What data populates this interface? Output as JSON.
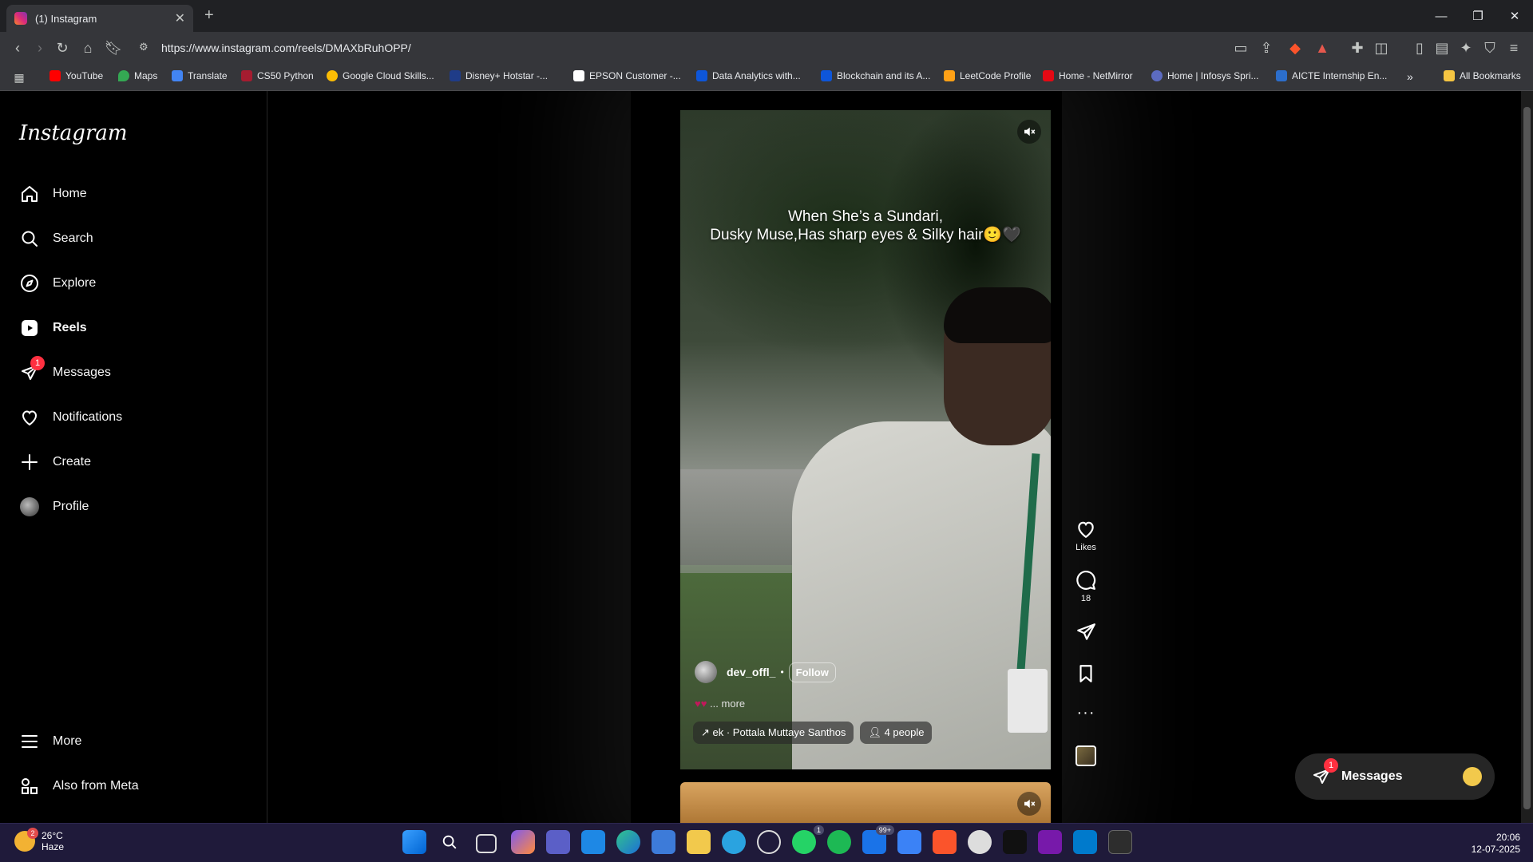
{
  "browser": {
    "tab_title": "(1) Instagram",
    "url": "https://www.instagram.com/reels/DMAXbRuhOPP/",
    "bookmarks": [
      "YouTube",
      "Maps",
      "Translate",
      "CS50 Python",
      "Google Cloud Skills...",
      "Disney+ Hotstar -...",
      "EPSON Customer -...",
      "Data Analytics with...",
      "Blockchain and its A...",
      "LeetCode Profile",
      "Home - NetMirror",
      "Home | Infosys Spri...",
      "AICTE Internship En..."
    ],
    "all_bookmarks": "All Bookmarks"
  },
  "sidebar": {
    "logo": "Instagram",
    "items": [
      {
        "label": "Home",
        "icon": "home-icon"
      },
      {
        "label": "Search",
        "icon": "search-icon"
      },
      {
        "label": "Explore",
        "icon": "compass-icon"
      },
      {
        "label": "Reels",
        "icon": "reels-icon"
      },
      {
        "label": "Messages",
        "icon": "messenger-icon",
        "badge": "1"
      },
      {
        "label": "Notifications",
        "icon": "heart-icon"
      },
      {
        "label": "Create",
        "icon": "plus-icon"
      },
      {
        "label": "Profile",
        "icon": "avatar-icon"
      }
    ],
    "more": "More",
    "meta": "Also from Meta"
  },
  "reel": {
    "overlay_line1": "When She’s a Sundari,",
    "overlay_line2": "Dusky Muse,Has sharp eyes & Silky hair🙂🖤",
    "username": "dev_offl_",
    "separator": "•",
    "follow": "Follow",
    "caption_more": "... more",
    "audio_chip": "↗ ek · Pottala Muttaye  Santhos",
    "people_chip": "4 people",
    "actions": {
      "likes_label": "Likes",
      "comments_count": "18"
    }
  },
  "messages_pill": {
    "label": "Messages",
    "badge": "1"
  },
  "taskbar": {
    "temp": "26°C",
    "condition": "Haze",
    "weather_badge": "2",
    "time": "20:06",
    "date": "12-07-2025",
    "mail_badge": "99+",
    "whatsapp_badge": "1"
  },
  "colors": {
    "accent_red": "#ff3040",
    "page_bg": "#000000",
    "taskbar_bg": "#1f1a3a"
  }
}
